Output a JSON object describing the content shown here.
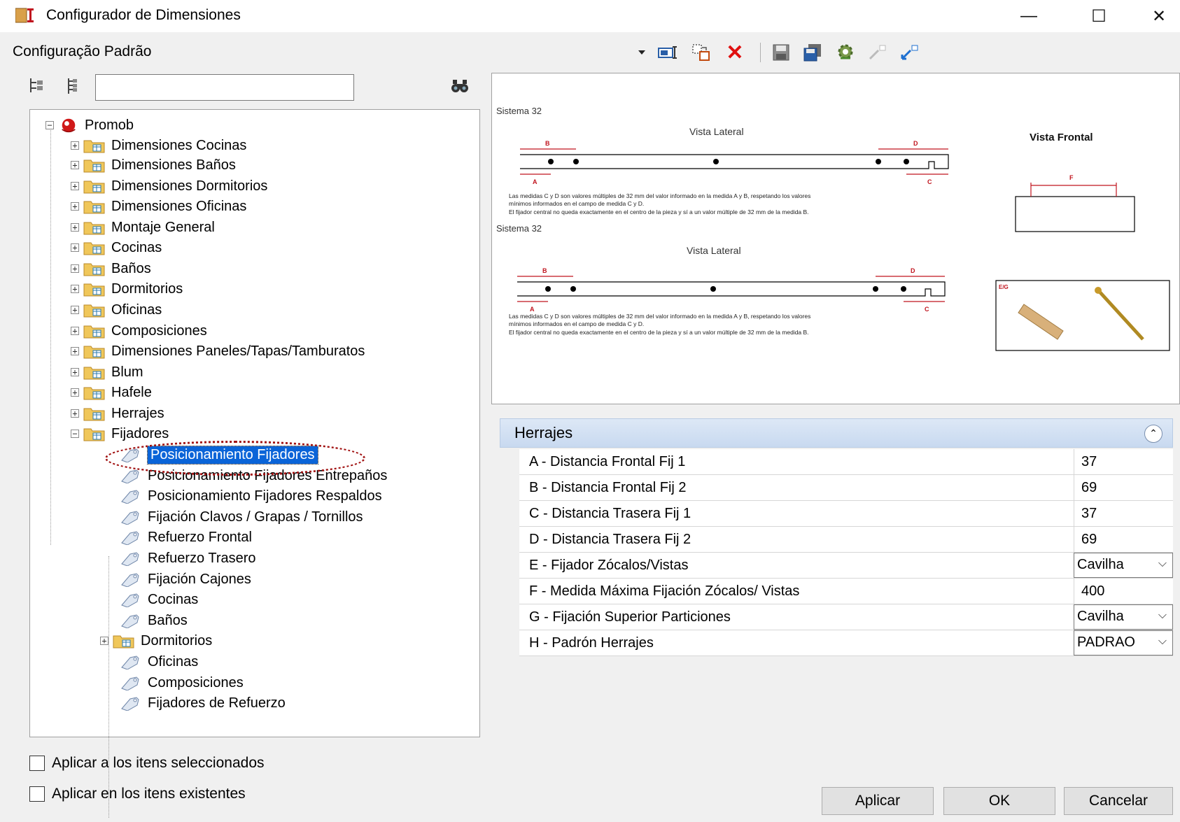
{
  "window": {
    "title": "Configurador de Dimensiones",
    "minimize_glyph": "—",
    "maximize_glyph": "☐",
    "close_glyph": "✕"
  },
  "config_name": "Configuração Padrão",
  "toolbar": {
    "icons": [
      "dropdown-arrow-icon",
      "rename-icon",
      "copy-icon",
      "delete-icon",
      "save-icon",
      "save-as-icon",
      "settings-icon",
      "import-icon",
      "export-icon"
    ]
  },
  "search": {
    "value": "",
    "placeholder": ""
  },
  "tree": {
    "root": "Promob",
    "level1": [
      "Dimensiones Cocinas",
      "Dimensiones Baños",
      "Dimensiones Dormitorios",
      "Dimensiones Oficinas",
      "Montaje General",
      "Cocinas",
      "Baños",
      "Dormitorios",
      "Oficinas",
      "Composiciones",
      "Dimensiones Paneles/Tapas/Tamburatos",
      "Blum",
      "Hafele",
      "Herrajes",
      "Fijadores"
    ],
    "fijadores_children": [
      "Posicionamiento Fijadores",
      "Posicionamiento Fijadores Entrepaños",
      "Posicionamiento Fijadores Respaldos",
      "Fijación Clavos / Grapas / Tornillos",
      "Refuerzo Frontal",
      "Refuerzo Trasero",
      "Fijación Cajones",
      "Cocinas",
      "Baños",
      "Dormitorios",
      "Oficinas",
      "Composiciones",
      "Fijadores de Refuerzo"
    ],
    "selected": "Posicionamiento Fijadores"
  },
  "diagram": {
    "section1_title": "Sistema 32",
    "section2_title": "Sistema 32",
    "vista_lateral": "Vista Lateral",
    "vista_frontal": "Vista Frontal",
    "labels": {
      "a": "A",
      "b": "B",
      "c": "C",
      "d": "D",
      "f": "F",
      "eg": "E/G"
    },
    "note_line1": "Las medidas C y D son valores múltiples de 32 mm del valor informado en la medida A y B, respetando los valores",
    "note_line2": "mínimos informados en el campo de medida C y D.",
    "note_line3": "El fijador central no queda exactamente en el centro de la pieza y sí a un valor múltiple de 32 mm de la medida B."
  },
  "properties": {
    "group_title": "Herrajes",
    "rows": [
      {
        "label": "A - Distancia Frontal Fij 1",
        "value": "37",
        "kind": "text"
      },
      {
        "label": "B - Distancia Frontal  Fij 2",
        "value": "69",
        "kind": "text"
      },
      {
        "label": "C - Distancia Trasera Fij 1",
        "value": "37",
        "kind": "text"
      },
      {
        "label": "D - Distancia Trasera Fij 2",
        "value": "69",
        "kind": "text"
      },
      {
        "label": "E - Fijador Zócalos/Vistas",
        "value": "Cavilha",
        "kind": "select"
      },
      {
        "label": "F - Medida Máxima Fijación Zócalos/ Vistas",
        "value": "400",
        "kind": "text"
      },
      {
        "label": "G - Fijación Superior Particiones",
        "value": "Cavilha",
        "kind": "select"
      },
      {
        "label": "H - Padrón Herrajes",
        "value": "PADRAO",
        "kind": "select"
      }
    ]
  },
  "options": {
    "apply_selected": "Aplicar a los itens seleccionados",
    "apply_existing": "Aplicar en los itens existentes"
  },
  "buttons": {
    "apply": "Aplicar",
    "ok": "OK",
    "cancel": "Cancelar"
  },
  "colors": {
    "selection": "#0a64d8",
    "header": "#c8d9f0",
    "dimension_red": "#c0141e",
    "folder": "#f0c75a",
    "highlight_oval": "#a01010"
  }
}
